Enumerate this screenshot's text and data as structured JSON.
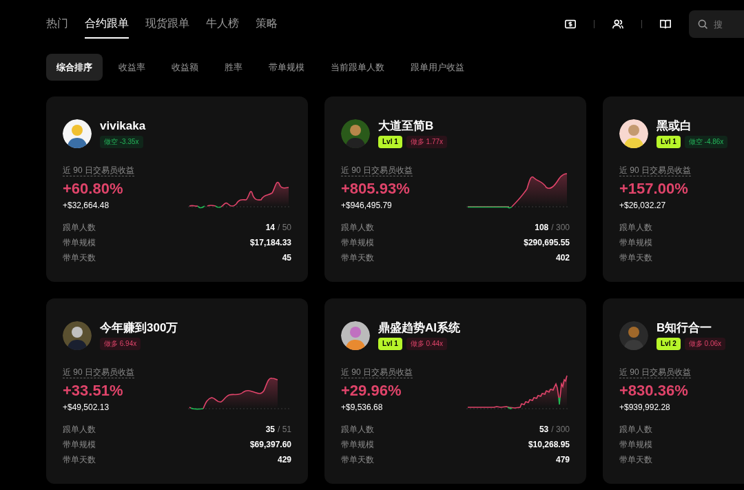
{
  "nav": {
    "tabs": [
      {
        "label": "热门",
        "selected": false
      },
      {
        "label": "合约跟单",
        "selected": true
      },
      {
        "label": "现货跟单",
        "selected": false
      },
      {
        "label": "牛人榜",
        "selected": false
      },
      {
        "label": "策略",
        "selected": false
      }
    ],
    "search": {
      "placeholder": "搜"
    }
  },
  "sort_tabs": [
    {
      "label": "综合排序",
      "selected": true
    },
    {
      "label": "收益率",
      "selected": false
    },
    {
      "label": "收益额",
      "selected": false
    },
    {
      "label": "胜率",
      "selected": false
    },
    {
      "label": "带单规模",
      "selected": false
    },
    {
      "label": "当前跟单人数",
      "selected": false
    },
    {
      "label": "跟单用户收益",
      "selected": false
    }
  ],
  "cards": [
    {
      "name": "vivikaka",
      "badges": [
        {
          "kind": "short",
          "label": "做空 -3.35x"
        }
      ],
      "metric_label": "近 90 日交易员收益",
      "roi": "+60.80%",
      "pnl": "+$32,664.48",
      "sparkline": {
        "kind": "choppy-rise"
      },
      "stats": [
        {
          "label": "跟单人数",
          "value": "14",
          "capacity": "/ 50"
        },
        {
          "label": "带单规模",
          "value": "$17,184.33"
        },
        {
          "label": "带单天数",
          "value": "45"
        }
      ]
    },
    {
      "name": "大道至简B",
      "badges": [
        {
          "kind": "level",
          "label": "Lvl 1"
        },
        {
          "kind": "long",
          "label": "做多 1.77x"
        }
      ],
      "metric_label": "近 90 日交易员收益",
      "roi": "+805.93%",
      "pnl": "+$946,495.79",
      "sparkline": {
        "kind": "late-surge"
      },
      "stats": [
        {
          "label": "跟单人数",
          "value": "108",
          "capacity": "/ 300"
        },
        {
          "label": "带单规模",
          "value": "$290,695.55"
        },
        {
          "label": "带单天数",
          "value": "402"
        }
      ]
    },
    {
      "name": "黑或白",
      "badges": [
        {
          "kind": "level",
          "label": "Lvl 1"
        },
        {
          "kind": "short",
          "label": "做空 -4.86x"
        }
      ],
      "metric_label": "近 90 日交易员收益",
      "roi": "+157.00%",
      "pnl": "+$26,032.27",
      "stats": [
        {
          "label": "跟单人数"
        },
        {
          "label": "带单规模"
        },
        {
          "label": "带单天数"
        }
      ]
    },
    {
      "name": "今年赚到300万",
      "badges": [
        {
          "kind": "long",
          "label": "做多 6.94x"
        }
      ],
      "metric_label": "近 90 日交易员收益",
      "roi": "+33.51%",
      "pnl": "+$49,502.13",
      "sparkline": {
        "kind": "step-rise"
      },
      "stats": [
        {
          "label": "跟单人数",
          "value": "35",
          "capacity": "/ 51"
        },
        {
          "label": "带单规模",
          "value": "$69,397.60"
        },
        {
          "label": "带单天数",
          "value": "429"
        }
      ]
    },
    {
      "name": "鼎盛趋势AI系统",
      "badges": [
        {
          "kind": "level",
          "label": "Lvl 1"
        },
        {
          "kind": "long",
          "label": "做多 0.44x"
        }
      ],
      "metric_label": "近 90 日交易员收益",
      "roi": "+29.96%",
      "pnl": "+$9,536.68",
      "sparkline": {
        "kind": "noisy-rise"
      },
      "stats": [
        {
          "label": "跟单人数",
          "value": "53",
          "capacity": "/ 300"
        },
        {
          "label": "带单规模",
          "value": "$10,268.95"
        },
        {
          "label": "带单天数",
          "value": "479"
        }
      ]
    },
    {
      "name": "B知行合一",
      "badges": [
        {
          "kind": "level",
          "label": "Lvl 2"
        },
        {
          "kind": "long",
          "label": "做多 0.06x"
        }
      ],
      "metric_label": "近 90 日交易员收益",
      "roi": "+830.36%",
      "pnl": "+$939,992.28",
      "stats": [
        {
          "label": "跟单人数"
        },
        {
          "label": "带单规模"
        },
        {
          "label": "带单天数"
        }
      ]
    }
  ]
}
